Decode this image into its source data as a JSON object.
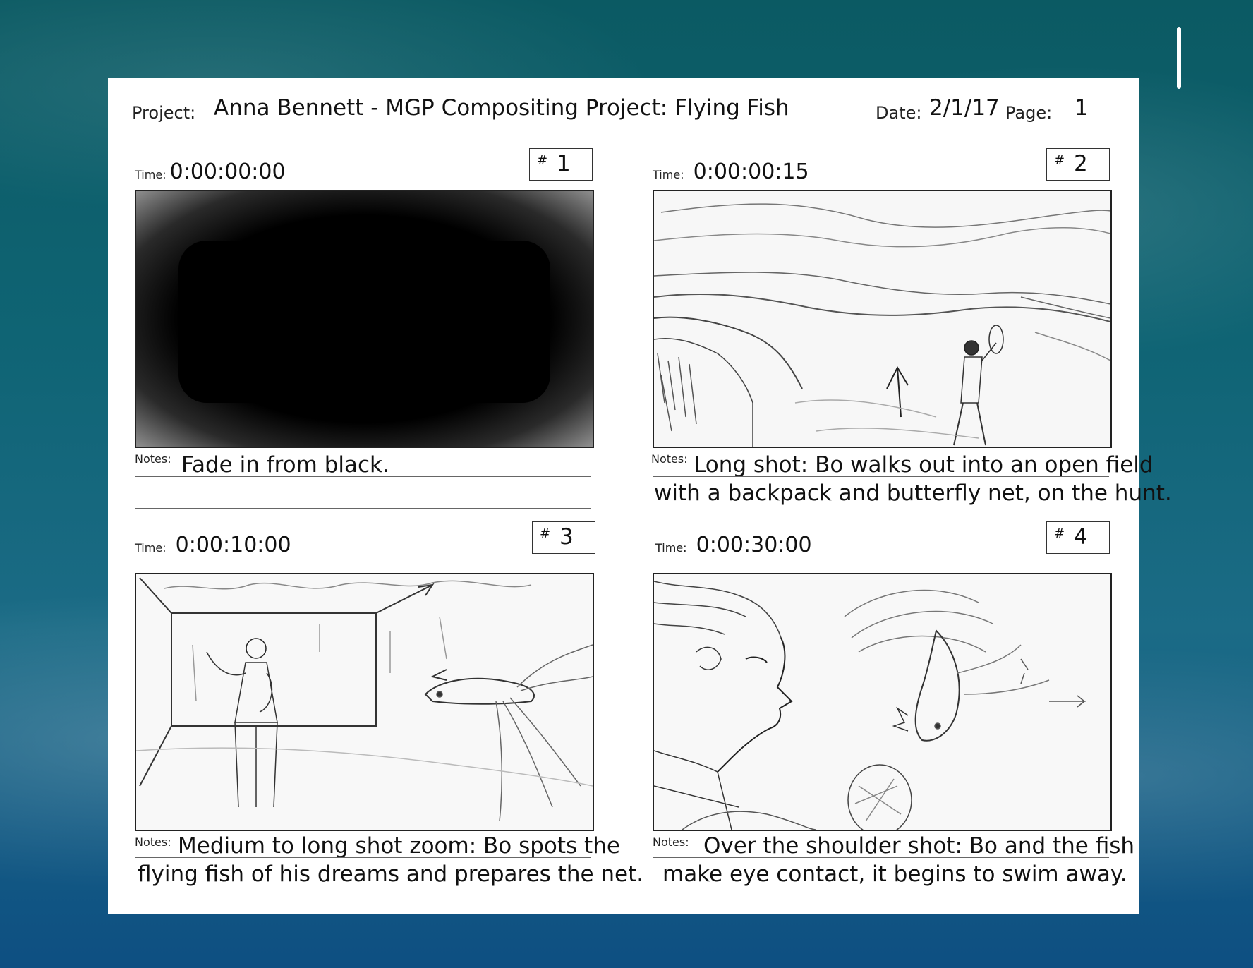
{
  "page_number": "1",
  "sheet": {
    "project_label": "Project:",
    "project_value": "Anna Bennett - MGP Compositing Project: Flying Fish",
    "date_label": "Date:",
    "date_value": "2/1/17",
    "page_label": "Page:",
    "page_value": "1",
    "time_label": "Time:",
    "notes_label": "Notes:",
    "hash": "#"
  },
  "panels": [
    {
      "number": "1",
      "time": "0:00:00:00",
      "notes_line1": "Fade in from black.",
      "notes_line2": ""
    },
    {
      "number": "2",
      "time": "0:00:00:15",
      "notes_line1": "Long shot: Bo walks out into an open field",
      "notes_line2": "with a backpack and butterfly net, on the hunt."
    },
    {
      "number": "3",
      "time": "0:00:10:00",
      "notes_line1": "Medium to long shot zoom: Bo spots the",
      "notes_line2": "flying fish of his dreams and prepares the net."
    },
    {
      "number": "4",
      "time": "0:00:30:00",
      "notes_line1": "Over the shoulder shot: Bo and the fish",
      "notes_line2": "make eye contact, it begins to swim away."
    }
  ]
}
